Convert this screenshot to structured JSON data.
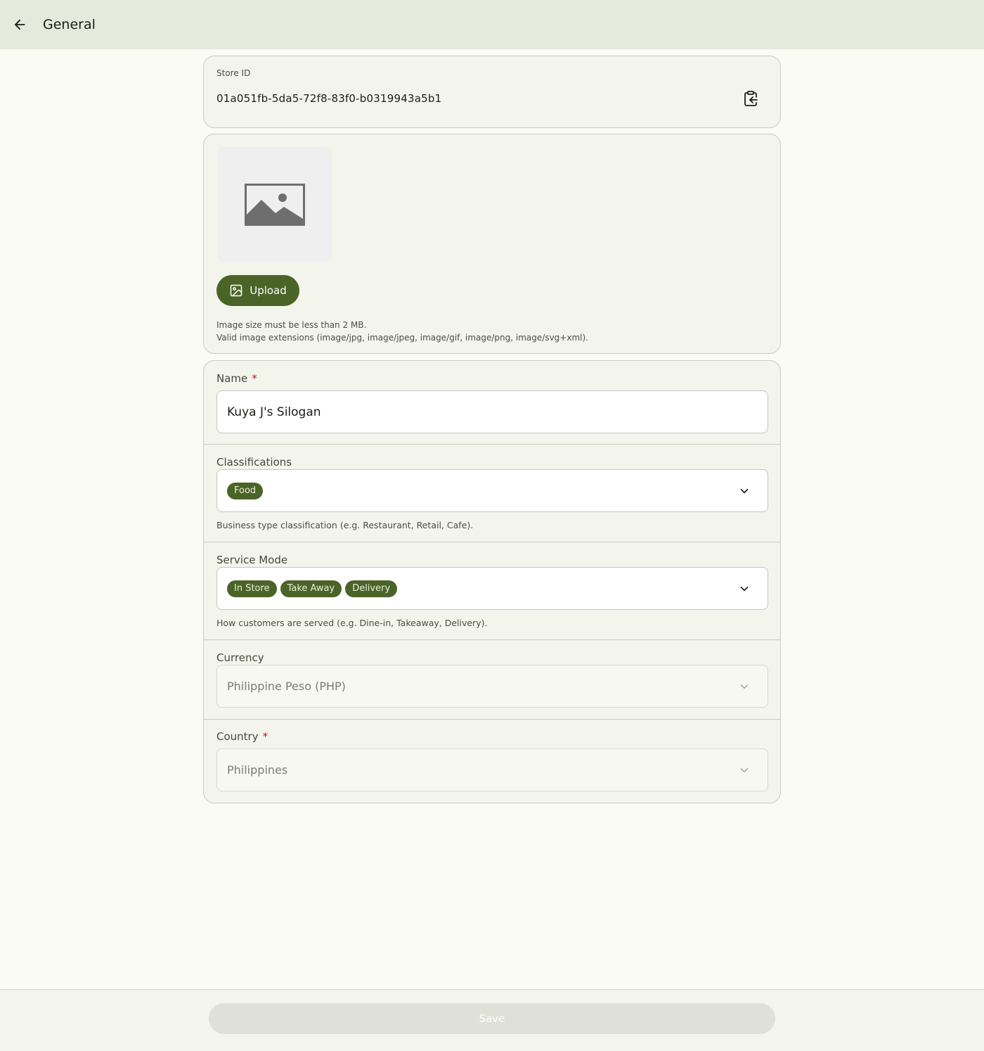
{
  "header": {
    "title": "General",
    "back_icon": "arrow-left-icon"
  },
  "store_id": {
    "label": "Store ID",
    "value": "01a051fb-5da5-72f8-83f0-b0319943a5b1",
    "copy_icon": "clipboard-copy-icon"
  },
  "image": {
    "placeholder_icon": "image-placeholder-icon",
    "upload_label": "Upload",
    "upload_icon": "image-icon",
    "help_line1": "Image size must be less than 2 MB.",
    "help_line2": "Valid image extensions (image/jpg, image/jpeg, image/gif, image/png, image/svg+xml)."
  },
  "form": {
    "name": {
      "label": "Name",
      "required_mark": "*",
      "value": "Kuya J's Silogan"
    },
    "classifications": {
      "label": "Classifications",
      "chips": [
        "Food"
      ],
      "helper": "Business type classification (e.g. Restaurant, Retail, Cafe)."
    },
    "service_mode": {
      "label": "Service Mode",
      "chips": [
        "In Store",
        "Take Away",
        "Delivery"
      ],
      "helper": "How customers are served (e.g. Dine-in, Takeaway, Delivery)."
    },
    "currency": {
      "label": "Currency",
      "value": "Philippine Peso (PHP)"
    },
    "country": {
      "label": "Country",
      "required_mark": "*",
      "value": "Philippines"
    }
  },
  "footer": {
    "save_label": "Save"
  },
  "colors": {
    "primary": "#4a6427",
    "header_bg": "#e5eadc",
    "required": "#ba1a1a"
  }
}
